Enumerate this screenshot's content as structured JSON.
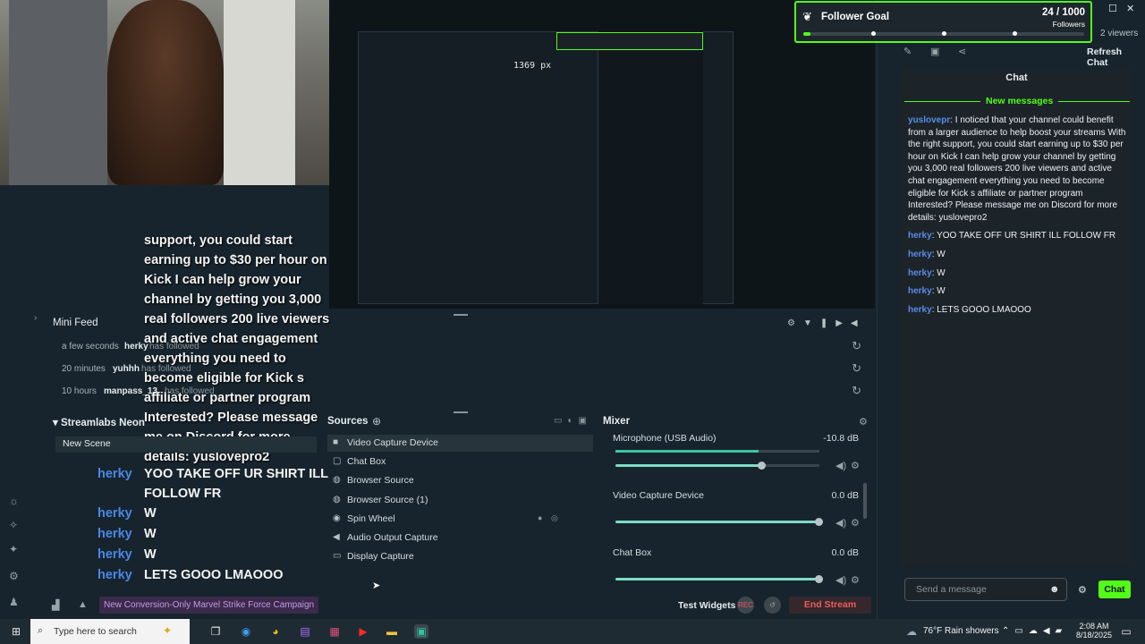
{
  "preview": {
    "measure_label": "1369 px"
  },
  "overlay_text": "support, you could start earning up to $30 per hour on Kick I can help grow your channel by getting you 3,000 real followers 200 live viewers and active chat engagement everything you need to become eligible for Kick s affiliate or partner program Interested? Please message me on Discord for more details: yuslovepro2",
  "overlay_chat": [
    {
      "user": "herky",
      "text": "YOO TAKE OFF UR SHIRT ILL FOLLOW FR"
    },
    {
      "user": "herky",
      "text": "W"
    },
    {
      "user": "herky",
      "text": "W"
    },
    {
      "user": "herky",
      "text": "W"
    },
    {
      "user": "herky",
      "text": "LETS GOOO LMAOOO"
    }
  ],
  "follower_goal": {
    "title": "Follower Goal",
    "count": "24 / 1000",
    "unit": "Followers",
    "progress": 0.024,
    "accent": "#53fc18"
  },
  "top_right": {
    "viewers": "2 viewers",
    "refresh": "Refresh Chat"
  },
  "mini_feed": {
    "title": "Mini Feed",
    "rows": [
      {
        "time": "a few seconds",
        "name": "herky",
        "action": "has followed"
      },
      {
        "time": "20 minutes",
        "name": "yuhhh",
        "action": "has followed"
      },
      {
        "time": "10 hours",
        "name": "manpass_13",
        "action": "has followed"
      }
    ]
  },
  "scenes": {
    "title": "Streamlabs Neon",
    "items": [
      "New Scene"
    ]
  },
  "sources": {
    "title": "Sources",
    "items": [
      {
        "label": "Video Capture Device",
        "icon": "camera-icon"
      },
      {
        "label": "Chat Box",
        "icon": "chat-icon"
      },
      {
        "label": "Browser Source",
        "icon": "globe-icon"
      },
      {
        "label": "Browser Source (1)",
        "icon": "globe-icon"
      },
      {
        "label": "Spin Wheel",
        "icon": "wheel-icon"
      },
      {
        "label": "Audio Output Capture",
        "icon": "speaker-icon"
      },
      {
        "label": "Display Capture",
        "icon": "monitor-icon"
      }
    ]
  },
  "mixer": {
    "title": "Mixer",
    "channels": [
      {
        "name": "Microphone (USB Audio)",
        "db": "-10.8 dB",
        "level": 0.7,
        "volume": 0.72
      },
      {
        "name": "Video Capture Device",
        "db": "0.0 dB",
        "level": 0.0,
        "volume": 1.0
      },
      {
        "name": "Chat Box",
        "db": "0.0 dB",
        "level": 0.0,
        "volume": 1.0
      }
    ]
  },
  "bottom": {
    "promo": "New Conversion-Only Marvel Strike Force Campaign",
    "test_widgets": "Test Widgets",
    "rec": "REC",
    "end_stream": "End Stream"
  },
  "chat": {
    "title": "Chat",
    "new_messages": "New messages",
    "messages": [
      {
        "user": "yuslovepr",
        "text": ": I noticed that your channel could benefit from a larger audience to help boost your streams With the right support, you could start earning up to $30 per hour on Kick I can help grow your channel by getting you 3,000 real followers 200 live viewers and active chat engagement everything you need to become eligible for Kick s affiliate or partner program Interested? Please message me on Discord for more details: yuslovepro2"
      },
      {
        "user": "herky",
        "text": ": YOO TAKE OFF UR SHIRT ILL FOLLOW FR"
      },
      {
        "user": "herky",
        "text": ": W"
      },
      {
        "user": "herky",
        "text": ": W"
      },
      {
        "user": "herky",
        "text": ": W"
      },
      {
        "user": "herky",
        "text": ": LETS GOOO LMAOOO"
      }
    ],
    "input_placeholder": "Send a message",
    "send": "Chat"
  },
  "taskbar": {
    "search_placeholder": "Type here to search",
    "weather": "76°F  Rain showers",
    "time": "2:08 AM",
    "date": "8/18/2025"
  }
}
